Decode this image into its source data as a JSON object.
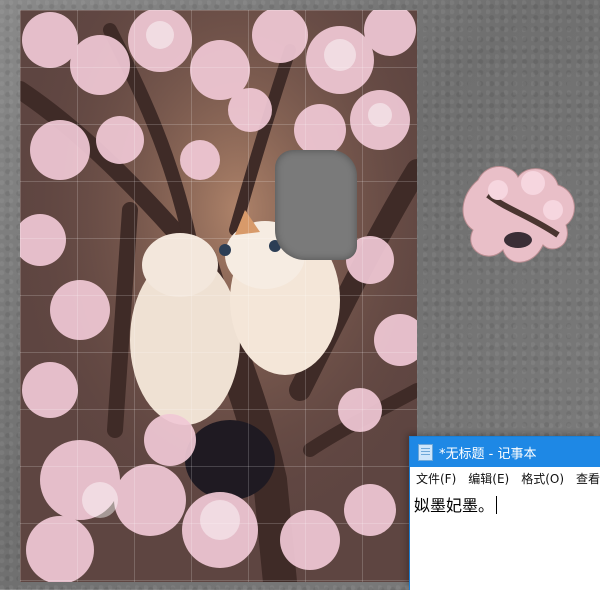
{
  "puzzle": {
    "image_subject": "cats-in-cherry-blossom-tree",
    "colors": {
      "blossom": "#f1c9d6",
      "branch": "#4a3530",
      "cat_fur": "#f4e8dc",
      "background": "#7a7a7a"
    }
  },
  "notepad": {
    "title": "*无标题 - 记事本",
    "menu": [
      "文件(F)",
      "编辑(E)",
      "格式(O)",
      "查看"
    ],
    "content": "姒墨妃墨。",
    "accent_color": "#1e88e5"
  }
}
